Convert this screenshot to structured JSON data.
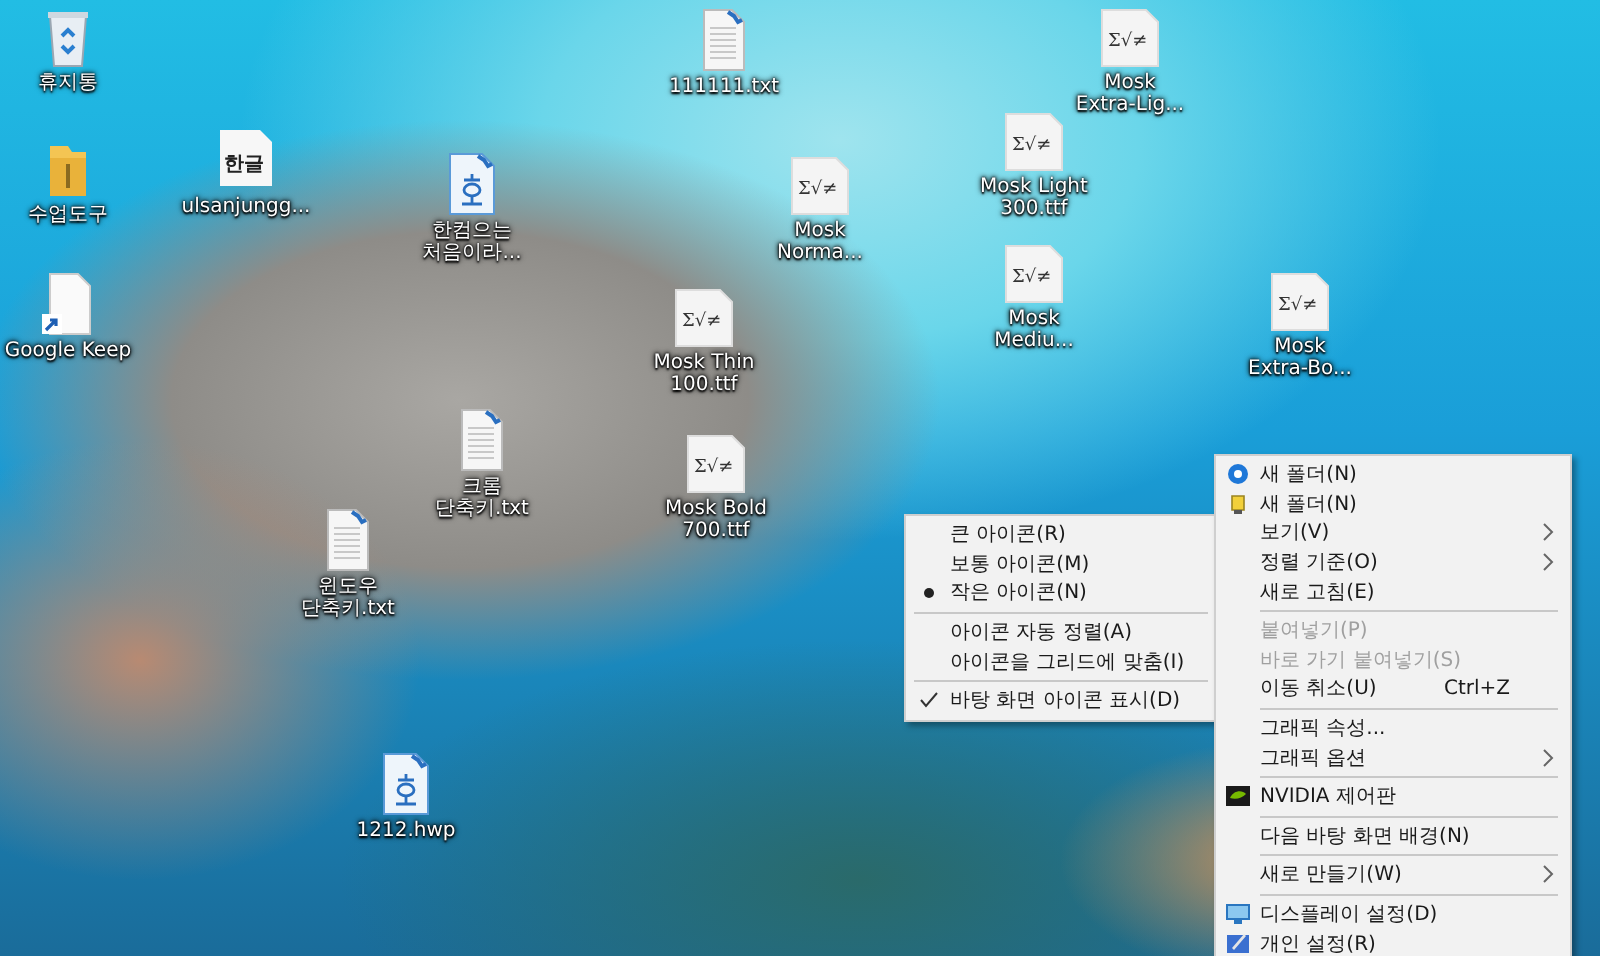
{
  "desktop_icons": [
    {
      "kind": "recycle-bin",
      "label": [
        "휴지통"
      ]
    },
    {
      "kind": "text",
      "label": [
        "111111.txt"
      ]
    },
    {
      "kind": "font",
      "glyph": "Σ√≠",
      "label": [
        "Mosk",
        "Extra-Lig..."
      ]
    },
    {
      "kind": "folder",
      "label": [
        "수업도구"
      ]
    },
    {
      "kind": "hangul",
      "glyph": "한글",
      "label": [
        "ulsanjungg..."
      ]
    },
    {
      "kind": "hwp",
      "label": [
        "한컴으는",
        "처음이라..."
      ]
    },
    {
      "kind": "font",
      "glyph": "Σ√≠",
      "label": [
        "Mosk",
        "Norma..."
      ]
    },
    {
      "kind": "font",
      "glyph": "Σ√≠",
      "label": [
        "Mosk Light",
        "300.ttf"
      ]
    },
    {
      "kind": "shortcut",
      "label": [
        "Google Keep"
      ]
    },
    {
      "kind": "font",
      "glyph": "Σ√≠",
      "label": [
        "Mosk Thin",
        "100.ttf"
      ]
    },
    {
      "kind": "font",
      "glyph": "Σ√≠",
      "label": [
        "Mosk",
        "Mediu..."
      ]
    },
    {
      "kind": "font",
      "glyph": "Σ√≠",
      "label": [
        "Mosk",
        "Extra-Bo..."
      ]
    },
    {
      "kind": "text",
      "label": [
        "크롬",
        "단축키.txt"
      ]
    },
    {
      "kind": "font",
      "glyph": "Σ√≠",
      "label": [
        "Mosk Bold",
        "700.ttf"
      ]
    },
    {
      "kind": "text",
      "label": [
        "윈도우",
        "단축키.txt"
      ]
    },
    {
      "kind": "hwp",
      "label": [
        "1212.hwp"
      ]
    }
  ],
  "view_submenu": [
    {
      "kind": "radio",
      "label": "큰 아이콘(R)",
      "selected": false
    },
    {
      "kind": "radio",
      "label": "보통 아이콘(M)",
      "selected": false
    },
    {
      "kind": "radio",
      "label": "작은 아이콘(N)",
      "selected": true
    },
    {
      "kind": "separator"
    },
    {
      "kind": "check",
      "label": "아이콘 자동 정렬(A)",
      "checked": false
    },
    {
      "kind": "check",
      "label": "아이콘을 그리드에 맞춤(I)",
      "checked": false
    },
    {
      "kind": "separator"
    },
    {
      "kind": "check",
      "label": "바탕 화면 아이콘 표시(D)",
      "checked": true
    }
  ],
  "context_menu": [
    {
      "kind": "item",
      "label": "새 폴더(N)",
      "disabled": false,
      "submenu": false
    },
    {
      "kind": "item",
      "label": "새 폴더(N)",
      "disabled": false,
      "submenu": false
    },
    {
      "kind": "item",
      "label": "보기(V)",
      "disabled": false,
      "submenu": true
    },
    {
      "kind": "item",
      "label": "정렬 기준(O)",
      "disabled": false,
      "submenu": true
    },
    {
      "kind": "item",
      "label": "새로 고침(E)",
      "disabled": false,
      "submenu": false
    },
    {
      "kind": "separator"
    },
    {
      "kind": "item",
      "label": "붙여넣기(P)",
      "disabled": true,
      "submenu": false
    },
    {
      "kind": "item",
      "label": "바로 가기 붙여넣기(S)",
      "disabled": true,
      "submenu": false
    },
    {
      "kind": "item",
      "label": "이동 취소(U)",
      "shortcut": "Ctrl+Z",
      "disabled": false,
      "submenu": false
    },
    {
      "kind": "separator"
    },
    {
      "kind": "item",
      "label": "그래픽 속성...",
      "disabled": false,
      "submenu": false
    },
    {
      "kind": "item",
      "label": "그래픽 옵션",
      "disabled": false,
      "submenu": true
    },
    {
      "kind": "separator"
    },
    {
      "kind": "item",
      "label": "NVIDIA 제어판",
      "disabled": false,
      "submenu": false
    },
    {
      "kind": "separator"
    },
    {
      "kind": "item",
      "label": "다음 바탕 화면 배경(N)",
      "disabled": false,
      "submenu": false
    },
    {
      "kind": "separator"
    },
    {
      "kind": "item",
      "label": "새로 만들기(W)",
      "disabled": false,
      "submenu": true
    },
    {
      "kind": "separator"
    },
    {
      "kind": "item",
      "label": "디스플레이 설정(D)",
      "disabled": false,
      "submenu": false
    },
    {
      "kind": "item",
      "label": "개인 설정(R)",
      "disabled": false,
      "submenu": false
    }
  ]
}
